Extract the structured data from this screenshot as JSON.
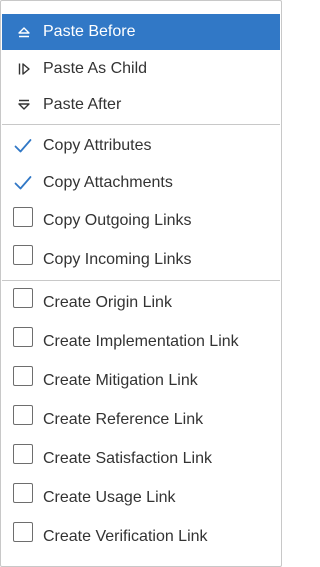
{
  "menu": {
    "paste_items": [
      {
        "label": "Paste Before",
        "icon": "paste-before-icon",
        "selected": true
      },
      {
        "label": "Paste As Child",
        "icon": "paste-as-child-icon",
        "selected": false
      },
      {
        "label": "Paste After",
        "icon": "paste-after-icon",
        "selected": false
      }
    ],
    "copy_items": [
      {
        "label": "Copy Attributes",
        "checked": true
      },
      {
        "label": "Copy Attachments",
        "checked": true
      },
      {
        "label": "Copy Outgoing Links",
        "checked": false
      },
      {
        "label": "Copy Incoming Links",
        "checked": false
      }
    ],
    "create_items": [
      {
        "label": "Create Origin Link",
        "checked": false
      },
      {
        "label": "Create Implementation Link",
        "checked": false
      },
      {
        "label": "Create Mitigation Link",
        "checked": false
      },
      {
        "label": "Create Reference Link",
        "checked": false
      },
      {
        "label": "Create Satisfaction Link",
        "checked": false
      },
      {
        "label": "Create Usage Link",
        "checked": false
      },
      {
        "label": "Create Verification Link",
        "checked": false
      }
    ]
  },
  "colors": {
    "selected_bg": "#3178c6",
    "checkmark": "#3178c6",
    "text": "#333333",
    "separator": "#c8c8c8"
  }
}
